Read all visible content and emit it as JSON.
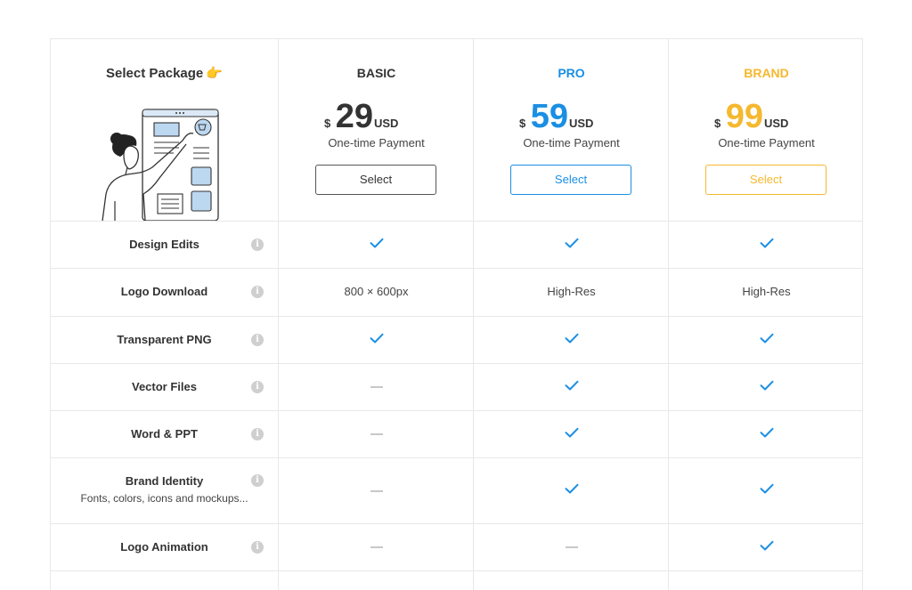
{
  "header": {
    "select_package": "Select Package",
    "hand_emoji": "👉"
  },
  "plans": [
    {
      "name": "BASIC",
      "currency": "$",
      "price": "29",
      "unit": "USD",
      "payment": "One-time Payment",
      "button": "Select",
      "color": "#333333"
    },
    {
      "name": "PRO",
      "currency": "$",
      "price": "59",
      "unit": "USD",
      "payment": "One-time Payment",
      "button": "Select",
      "color": "#1a8fe3"
    },
    {
      "name": "BRAND",
      "currency": "$",
      "price": "99",
      "unit": "USD",
      "payment": "One-time Payment",
      "button": "Select",
      "color": "#f5b82e"
    }
  ],
  "features": [
    {
      "label": "Design Edits",
      "values": [
        "check",
        "check",
        "check"
      ]
    },
    {
      "label": "Logo Download",
      "values": [
        "800 × 600px",
        "High-Res",
        "High-Res"
      ]
    },
    {
      "label": "Transparent PNG",
      "values": [
        "check",
        "check",
        "check"
      ]
    },
    {
      "label": "Vector Files",
      "values": [
        "dash",
        "check",
        "check"
      ]
    },
    {
      "label": "Word & PPT",
      "values": [
        "dash",
        "check",
        "check"
      ]
    },
    {
      "label": "Brand Identity",
      "sublabel": "Fonts, colors, icons and mockups...",
      "values": [
        "dash",
        "check",
        "check"
      ]
    },
    {
      "label": "Logo Animation",
      "values": [
        "dash",
        "dash",
        "check"
      ]
    }
  ],
  "icons": {
    "check": "check-icon",
    "dash": "dash-icon",
    "info": "info-icon"
  },
  "info_glyph": "i",
  "check_color": "#1a8fe3"
}
